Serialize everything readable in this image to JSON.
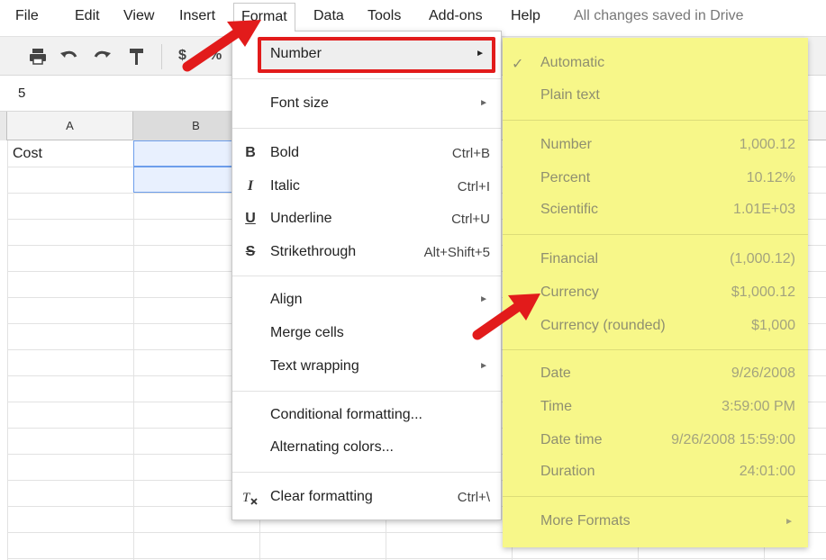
{
  "menubar": {
    "items": [
      "File",
      "Edit",
      "View",
      "Insert",
      "Format",
      "Data",
      "Tools",
      "Add-ons",
      "Help"
    ],
    "save_status": "All changes saved in Drive"
  },
  "toolbar": {
    "icons": [
      "print-icon",
      "undo-icon",
      "redo-icon",
      "paint-format-icon"
    ],
    "currency_symbol": "$",
    "percent_symbol": "%"
  },
  "formula_bar": {
    "cell_value": "5"
  },
  "grid": {
    "columns": [
      "A",
      "B"
    ],
    "selected_column": "B",
    "cells": {
      "A1": "Cost"
    }
  },
  "format_menu": {
    "number": "Number",
    "font_size": "Font size",
    "bold": {
      "label": "Bold",
      "shortcut": "Ctrl+B",
      "icon": "B"
    },
    "italic": {
      "label": "Italic",
      "shortcut": "Ctrl+I",
      "icon": "I"
    },
    "underline": {
      "label": "Underline",
      "shortcut": "Ctrl+U",
      "icon": "U"
    },
    "strikethrough": {
      "label": "Strikethrough",
      "shortcut": "Alt+Shift+5",
      "icon": "S"
    },
    "align": "Align",
    "merge_cells": "Merge cells",
    "text_wrapping": "Text wrapping",
    "conditional_formatting": "Conditional formatting...",
    "alternating_colors": "Alternating colors...",
    "clear_formatting": {
      "label": "Clear formatting",
      "shortcut": "Ctrl+\\"
    }
  },
  "number_submenu": {
    "automatic": "Automatic",
    "plain_text": "Plain text",
    "number": {
      "label": "Number",
      "example": "1,000.12"
    },
    "percent": {
      "label": "Percent",
      "example": "10.12%"
    },
    "scientific": {
      "label": "Scientific",
      "example": "1.01E+03"
    },
    "financial": {
      "label": "Financial",
      "example": "(1,000.12)"
    },
    "currency": {
      "label": "Currency",
      "example": "$1,000.12"
    },
    "currency_rounded": {
      "label": "Currency (rounded)",
      "example": "$1,000"
    },
    "date": {
      "label": "Date",
      "example": "9/26/2008"
    },
    "time": {
      "label": "Time",
      "example": "3:59:00 PM"
    },
    "date_time": {
      "label": "Date time",
      "example": "9/26/2008 15:59:00"
    },
    "duration": {
      "label": "Duration",
      "example": "24:01:00"
    },
    "more_formats": "More Formats"
  },
  "colors": {
    "submenu_highlight": "#f7f789",
    "annotation_red": "#e21b1b",
    "selection_blue": "#6d9eeb"
  }
}
